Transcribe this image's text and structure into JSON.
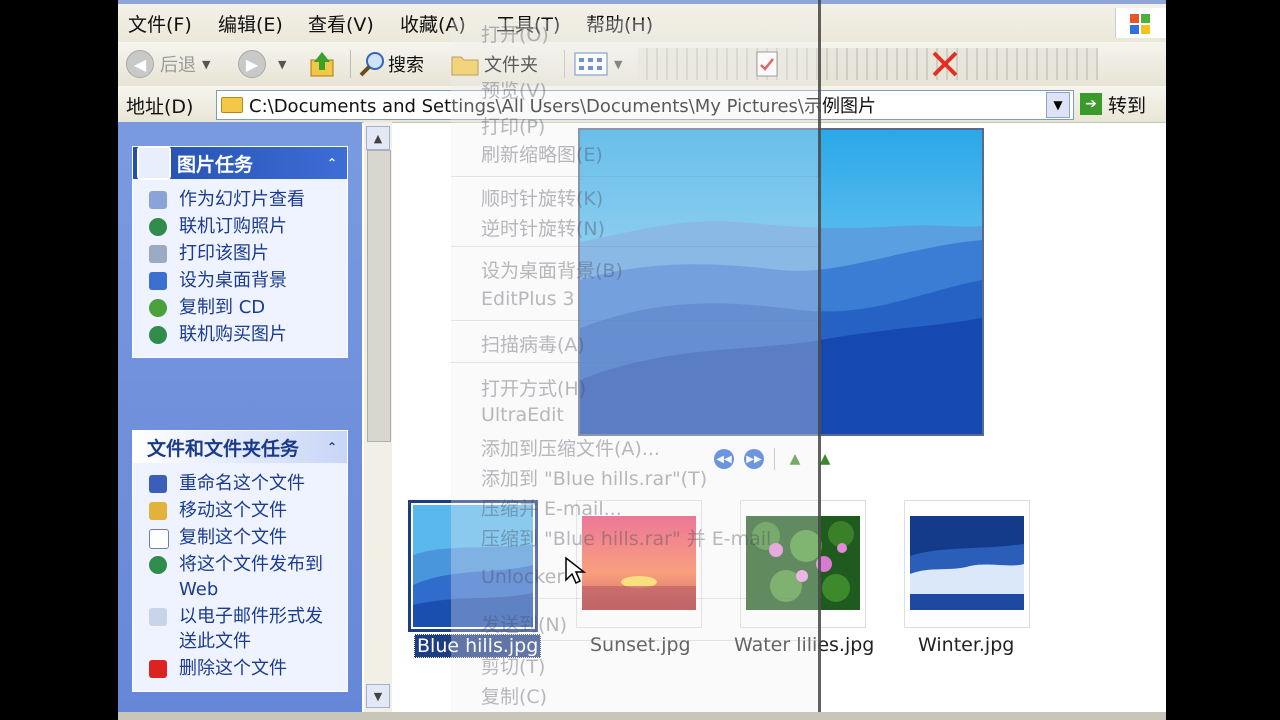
{
  "menubar": {
    "items": [
      "文件(F)",
      "编辑(E)",
      "查看(V)",
      "收藏(A)",
      "工具(T)",
      "帮助(H)"
    ]
  },
  "toolbar": {
    "back_label": "后退",
    "search_label": "搜索",
    "folders_label": "文件夹"
  },
  "address": {
    "label": "地址(D)",
    "path": "C:\\Documents and Settings\\All Users\\Documents\\My Pictures\\示例图片",
    "go_label": "转到"
  },
  "picture_tasks": {
    "title": "图片任务",
    "items": [
      "作为幻灯片查看",
      "联机订购照片",
      "打印该图片",
      "设为桌面背景",
      "复制到 CD",
      "联机购买图片"
    ]
  },
  "file_tasks": {
    "title": "文件和文件夹任务",
    "items": [
      "重命名这个文件",
      "移动这个文件",
      "复制这个文件",
      "将这个文件发布到 Web",
      "以电子邮件形式发送此文件",
      "删除这个文件"
    ]
  },
  "thumbnails": [
    {
      "name": "Blue hills.jpg",
      "selected": true
    },
    {
      "name": "Sunset.jpg",
      "selected": false
    },
    {
      "name": "Water lilies.jpg",
      "selected": false
    },
    {
      "name": "Winter.jpg",
      "selected": false
    }
  ],
  "context_menu": {
    "items": [
      "打开(O)",
      "预览(V)",
      "打印(P)",
      "刷新缩略图(E)",
      "顺时针旋转(K)",
      "逆时针旋转(N)",
      "设为桌面背景(B)",
      "EditPlus 3",
      "扫描病毒(A)",
      "打开方式(H)",
      "UltraEdit",
      "添加到压缩文件(A)...",
      "添加到 \"Blue hills.rar\"(T)",
      "压缩并 E-mail...",
      "压缩到 \"Blue hills.rar\" 并 E-mail",
      "Unlocker",
      "发送到(N)",
      "剪切(T)",
      "复制(C)"
    ]
  },
  "colors": {
    "titlebar_blue": "#234fae",
    "selection": "#1c3c84",
    "task_pane": "#6d8dde"
  }
}
